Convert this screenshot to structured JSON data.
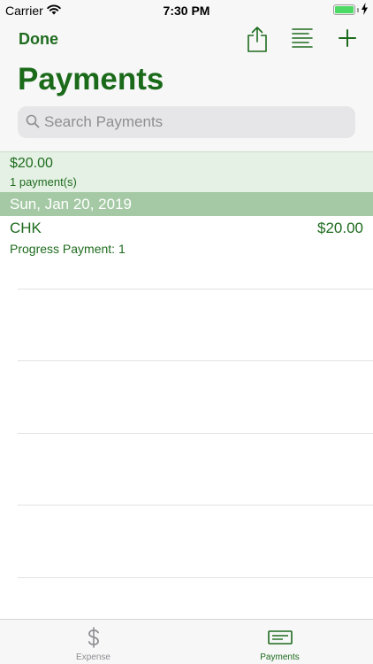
{
  "status": {
    "carrier": "Carrier",
    "time": "7:30 PM"
  },
  "nav": {
    "done_label": "Done",
    "title": "Payments",
    "icons": [
      "share-icon",
      "list-icon",
      "add-icon"
    ]
  },
  "search": {
    "placeholder": "Search Payments",
    "value": ""
  },
  "summary": {
    "amount": "$20.00",
    "count": "1 payment(s)"
  },
  "sections": [
    {
      "header": "Sun, Jan 20, 2019",
      "rows": [
        {
          "type": "CHK",
          "amount": "$20.00",
          "description": "Progress Payment: 1"
        }
      ]
    }
  ],
  "tabs": [
    {
      "label": "Expense",
      "icon": "dollar-icon",
      "selected": false
    },
    {
      "label": "Payments",
      "icon": "check-icon",
      "selected": true
    }
  ],
  "colors": {
    "accent": "#1e6b1e",
    "section_bg": "#a5c9a5",
    "summary_bg": "#e5f1e5",
    "inactive": "#8e8e93"
  }
}
